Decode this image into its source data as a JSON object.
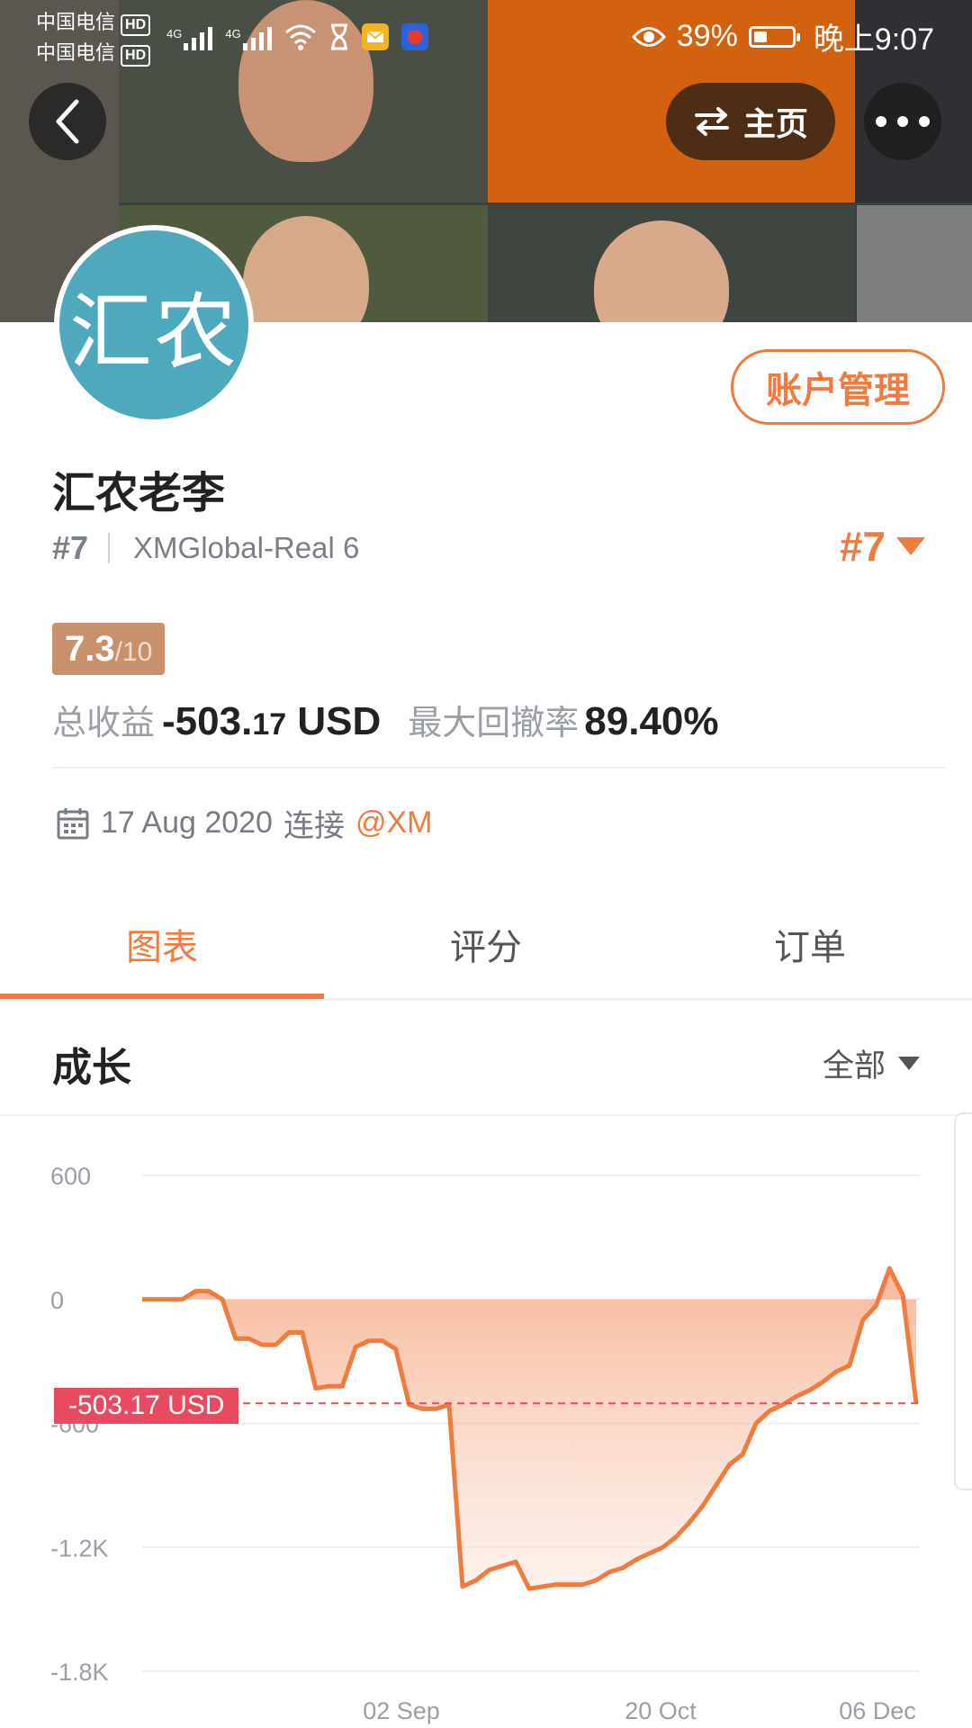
{
  "status_bar": {
    "carrier1": "中国电信",
    "carrier2": "中国电信",
    "hd": "HD",
    "net1": "4G",
    "net2": "4G",
    "battery_pct": "39%",
    "time": "晚上9:07"
  },
  "header": {
    "home_label": "主页"
  },
  "profile": {
    "avatar_text": "汇农",
    "account_button": "账户管理",
    "name": "汇农老李",
    "rank": "#7",
    "account": "XMGlobal-Real 6",
    "rank_right": "#7",
    "score_value": "7.3",
    "score_max": "/10",
    "total_profit_label": "总收益",
    "total_profit_value": "-503.",
    "total_profit_decimals": "17",
    "total_profit_unit": "USD",
    "max_drawdown_label": "最大回撤率",
    "max_drawdown_value": "89.40%",
    "connect_date": "17 Aug 2020",
    "connect_label": "连接",
    "connect_broker": "@XM"
  },
  "tabs": [
    {
      "label": "图表",
      "active": true
    },
    {
      "label": "评分",
      "active": false
    },
    {
      "label": "订单",
      "active": false
    }
  ],
  "growth": {
    "title": "成长",
    "range": "全部",
    "current_label": "-503.17 USD"
  },
  "colors": {
    "accent": "#f07b3f",
    "score_badge": "#c8906b",
    "current_line": "#e84b5f"
  },
  "chart_data": {
    "type": "area",
    "y_ticks": [
      "600",
      "0",
      "-600",
      "-1.2K",
      "-1.8K"
    ],
    "y_tick_values": [
      600,
      0,
      -600,
      -1200,
      -1800
    ],
    "x_ticks": [
      "02 Sep",
      "20 Oct",
      "06 Dec"
    ],
    "ylim": [
      -1800,
      600
    ],
    "current_value": -503.17,
    "series": [
      {
        "values": [
          0,
          0,
          0,
          0,
          40,
          40,
          0,
          -190,
          -190,
          -220,
          -220,
          -160,
          -160,
          -430,
          -420,
          -420,
          -230,
          -200,
          -200,
          -240,
          -510,
          -530,
          -530,
          -510,
          -1390,
          -1360,
          -1310,
          -1290,
          -1270,
          -1400,
          -1390,
          -1380,
          -1380,
          -1380,
          -1360,
          -1320,
          -1300,
          -1260,
          -1230,
          -1200,
          -1150,
          -1080,
          -1000,
          -900,
          -800,
          -750,
          -600,
          -540,
          -510,
          -470,
          -440,
          -400,
          -350,
          -320,
          -100,
          -30,
          150,
          20,
          -503.17
        ]
      }
    ]
  }
}
